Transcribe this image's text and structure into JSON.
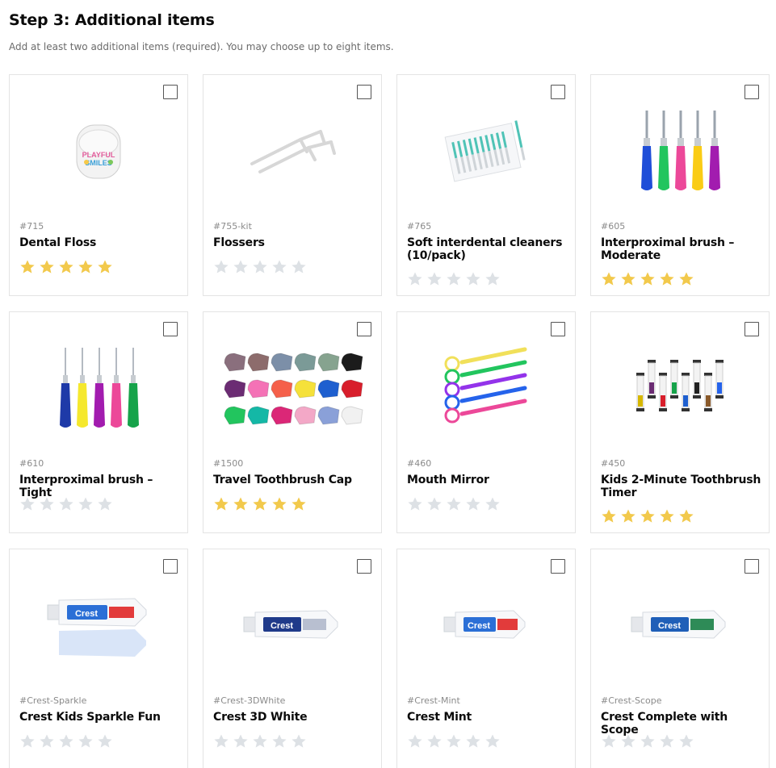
{
  "header": {
    "title": "Step 3: Additional items",
    "subtitle": "Add at least two additional items (required). You may choose up to eight items."
  },
  "colors": {
    "star_filled": "#f2c94c",
    "star_empty": "#dde1e5",
    "border": "#e4e4e4"
  },
  "items": [
    {
      "sku": "#715",
      "name": "Dental Floss",
      "rating": 5,
      "icon": "dental-floss-image",
      "lines": 1
    },
    {
      "sku": "#755-kit",
      "name": "Flossers",
      "rating": 0,
      "icon": "flossers-image",
      "lines": 1
    },
    {
      "sku": "#765",
      "name": "Soft interdental cleaners (10/pack)",
      "rating": 0,
      "icon": "interdental-cleaners-image",
      "lines": 2
    },
    {
      "sku": "#605",
      "name": "Interproximal brush – Moderate",
      "rating": 5,
      "icon": "interproximal-brush-moderate-image",
      "lines": 2
    },
    {
      "sku": "#610",
      "name": "Interproximal brush – Tight",
      "rating": 0,
      "icon": "interproximal-brush-tight-image",
      "lines": 1
    },
    {
      "sku": "#1500",
      "name": "Travel Toothbrush Cap",
      "rating": 5,
      "icon": "toothbrush-cap-image",
      "lines": 1
    },
    {
      "sku": "#460",
      "name": "Mouth Mirror",
      "rating": 0,
      "icon": "mouth-mirror-image",
      "lines": 1
    },
    {
      "sku": "#450",
      "name": "Kids 2-Minute Toothbrush Timer",
      "rating": 5,
      "icon": "toothbrush-timer-image",
      "lines": 2
    },
    {
      "sku": "#Crest-Sparkle",
      "name": "Crest Kids Sparkle Fun",
      "rating": 0,
      "icon": "toothpaste-sparkle-image",
      "lines": 1
    },
    {
      "sku": "#Crest-3DWhite",
      "name": "Crest 3D White",
      "rating": 0,
      "icon": "toothpaste-3dwhite-image",
      "lines": 1
    },
    {
      "sku": "#Crest-Mint",
      "name": "Crest Mint",
      "rating": 0,
      "icon": "toothpaste-mint-image",
      "lines": 1
    },
    {
      "sku": "#Crest-Scope",
      "name": "Crest Complete with Scope",
      "rating": 0,
      "icon": "toothpaste-scope-image",
      "lines": 1
    }
  ]
}
